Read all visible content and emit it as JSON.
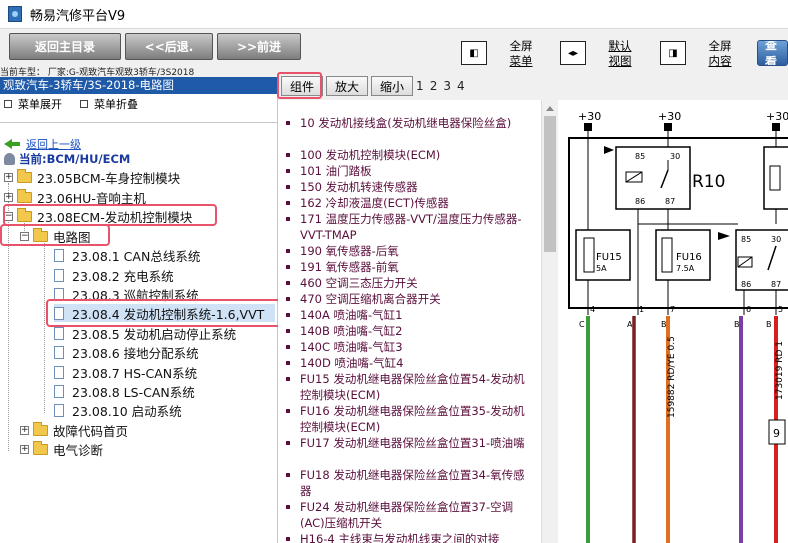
{
  "window": {
    "title": "畅易汽修平台V9"
  },
  "toolbar": {
    "home": "返回主目录",
    "back": "<<后退.",
    "forward": ">>前进",
    "full_menu": [
      "全屏",
      "菜单"
    ],
    "default_view": [
      "默认",
      "视图"
    ],
    "full_content": [
      "全屏",
      "内容"
    ],
    "search": "查看"
  },
  "vehicle_info": "当前车型：  厂家:G-观致汽车观致3轿车/3S2018",
  "left": {
    "path": "观致汽车-3轿车/3S-2018-电路图",
    "expand_menu": "菜单展开",
    "collapse_menu": "菜单折叠",
    "back_link": "返回上一级",
    "current": "当前:BCM/HU/ECM",
    "tree": [
      "23.05BCM-车身控制模块",
      "23.06HU-音响主机",
      "23.08ECM-发动机控制模块",
      "电路图",
      "23.08.1 CAN总线系统",
      "23.08.2 充电系统",
      "23.08.3 巡航控制系统",
      "23.08.4 发动机控制系统-1.6,VVT",
      "23.08.5 发动机启动停止系统",
      "23.08.6 接地分配系统",
      "23.08.7 HS-CAN系统",
      "23.08.8 LS-CAN系统",
      "23.08.10 启动系统",
      "故障代码首页",
      "电气诊断"
    ]
  },
  "tabs": {
    "component": "组件",
    "zoom_in": "放大",
    "zoom_out": "缩小",
    "pages": [
      "1",
      "2",
      "3",
      "4"
    ]
  },
  "components": [
    "10 发动机接线盒(发动机继电器保险丝盒)",
    "100 发动机控制模块(ECM)",
    "101 油门踏板",
    "150 发动机转速传感器",
    "162 冷却液温度(ECT)传感器",
    "171 温度压力传感器-VVT/温度压力传感器-VVT-TMAP",
    "190 氧传感器-后氧",
    "191 氧传感器-前氧",
    "460 空调三态压力开关",
    "470 空调压缩机离合器开关",
    "140A 喷油嘴-气缸1",
    "140B 喷油嘴-气缸2",
    "140C 喷油嘴-气缸3",
    "140D 喷油嘴-气缸4",
    "FU15 发动机继电器保险丝盒位置54-发动机控制模块(ECM)",
    "FU16 发动机继电器保险丝盒位置35-发动机控制模块(ECM)",
    "FU17 发动机继电器保险丝盒位置31-喷油嘴",
    "FU18 发动机继电器保险丝盒位置34-氧传感器",
    "FU24 发动机继电器保险丝盒位置37-空调(AC)压缩机开关",
    "H16-4 主线束与发动机线束之间的对接"
  ],
  "diagram": {
    "supply": [
      "+30",
      "+30",
      "+30"
    ],
    "relay_label": "R10",
    "relay_pins": [
      "85",
      "30",
      "86",
      "87"
    ],
    "fuses": [
      {
        "name": "FU15",
        "rating": "5A"
      },
      {
        "name": "FU16",
        "rating": "7.5A"
      }
    ],
    "relay2_pins": [
      "85",
      "30",
      "86",
      "87"
    ],
    "pins": [
      "4",
      "1",
      "7",
      "6",
      "5"
    ],
    "wire_codes": [
      "C",
      "A",
      "B",
      "B",
      "B"
    ],
    "wire_labels": [
      "159882 RD/YE 0.5",
      "173019 RD 1"
    ],
    "connector_pin": "9",
    "colors": {
      "green": "#3a9d3a",
      "orange": "#e0701f",
      "purple": "#7a3fa0",
      "red": "#d62020"
    }
  }
}
